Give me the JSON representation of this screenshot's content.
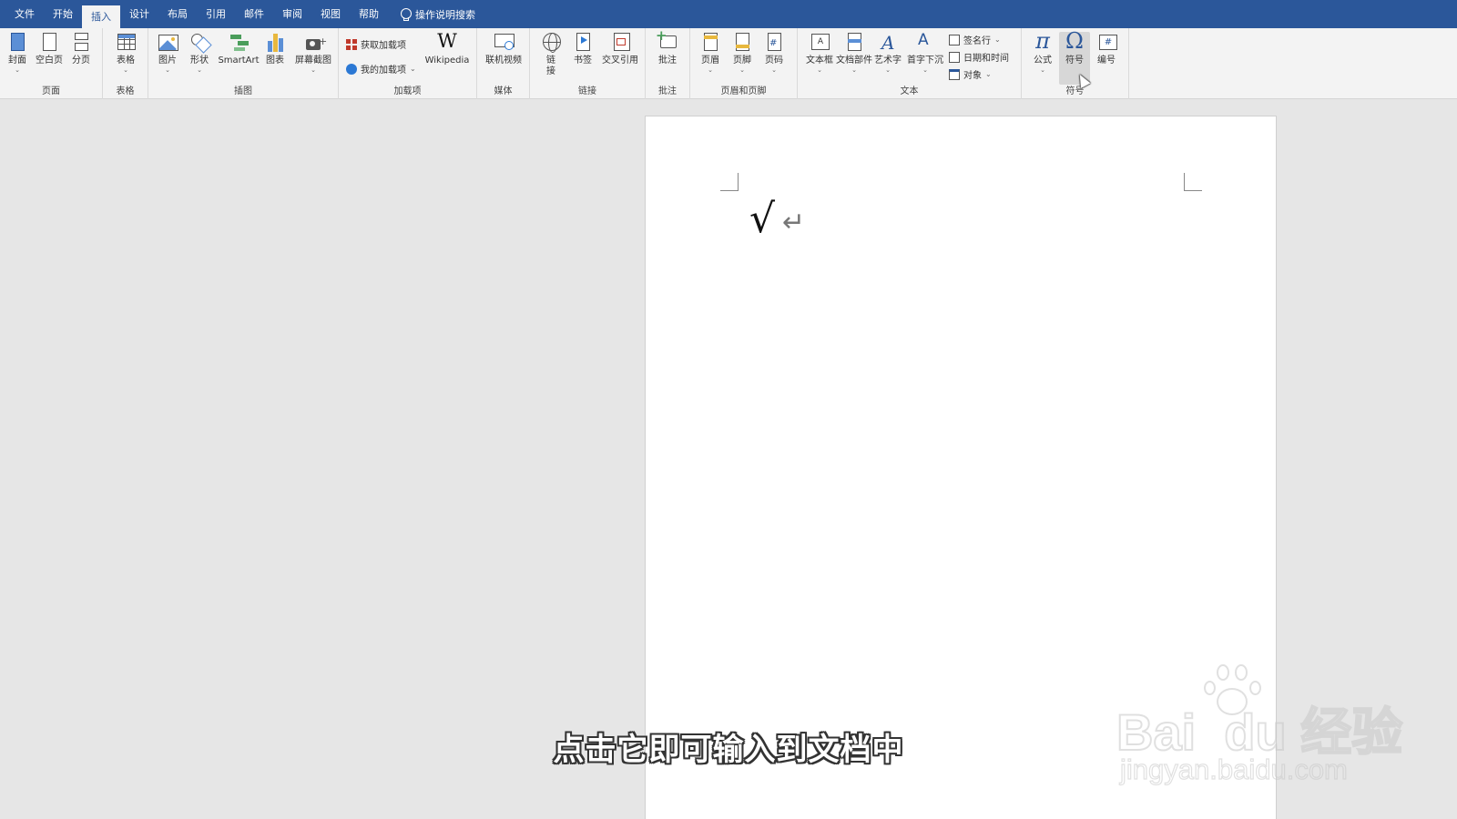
{
  "tabs": [
    "文件",
    "开始",
    "插入",
    "设计",
    "布局",
    "引用",
    "邮件",
    "审阅",
    "视图",
    "帮助"
  ],
  "active_tab": "插入",
  "tell_me": "操作说明搜索",
  "ribbon": {
    "groups": {
      "pages": "页面",
      "tables": "表格",
      "illustrations": "插图",
      "addins": "加载项",
      "media": "媒体",
      "links": "链接",
      "comments": "批注",
      "header_footer": "页眉和页脚",
      "text": "文本",
      "symbols": "符号"
    },
    "buttons": {
      "cover": "封面",
      "blank_page": "空白页",
      "page_break": "分页",
      "table": "表格",
      "picture": "图片",
      "shapes": "形状",
      "smartart": "SmartArt",
      "chart": "图表",
      "screenshot": "屏幕截图",
      "get_addins": "获取加载项",
      "my_addins": "我的加载项",
      "wikipedia": "Wikipedia",
      "online_video": "联机视频",
      "link_1": "链",
      "link_2": "接",
      "bookmark": "书签",
      "cross_ref": "交叉引用",
      "comment": "批注",
      "header": "页眉",
      "footer": "页脚",
      "page_number": "页码",
      "textbox": "文本框",
      "quick_parts": "文档部件",
      "wordart": "艺术字",
      "drop_cap": "首字下沉",
      "signature_line": "签名行",
      "date_time": "日期和时间",
      "object": "对象",
      "equation": "公式",
      "symbol": "符号",
      "numbering": "编号"
    },
    "icon_glyphs": {
      "pi": "π",
      "omega": "Ω",
      "wiki": "W",
      "hash": "#",
      "textbox": "A",
      "wordart": "A",
      "dropcap": "A"
    }
  },
  "document": {
    "content": "√",
    "paragraph_mark": "↵"
  },
  "subtitle": "点击它即可输入到文档中",
  "colors": {
    "title_bar": "#2b579a",
    "ribbon_bg": "#f3f3f3",
    "canvas": "#e6e6e6"
  }
}
